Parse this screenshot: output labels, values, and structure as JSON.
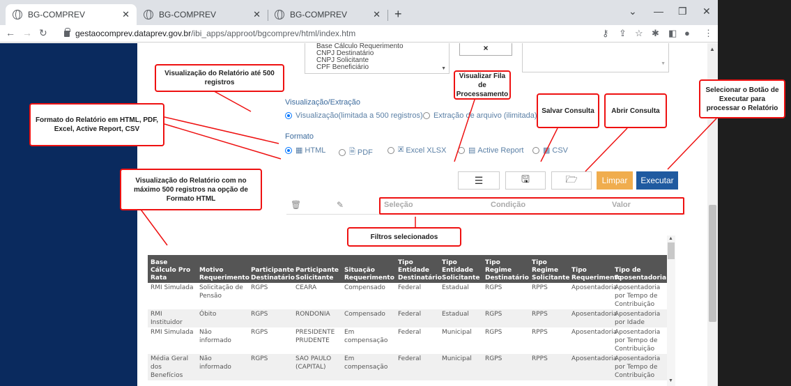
{
  "browser": {
    "tabs": [
      {
        "title": "BG-COMPREV",
        "active": true
      },
      {
        "title": "BG-COMPREV",
        "active": false
      },
      {
        "title": "BG-COMPREV",
        "active": false
      }
    ],
    "url_domain": "gestaocomprev.dataprev.gov.br",
    "url_path": "/ibi_apps/approot/bgcomprev/html/index.htm"
  },
  "listbox_items": [
    "Base Cálculo Requerimento",
    "CNPJ Destinatário",
    "CNPJ Solicitante",
    "CPF Beneficiário"
  ],
  "remove_button": "×",
  "visualizacao": {
    "label": "Visualização/Extração",
    "options": [
      {
        "label": "Visualização(limitada a 500 registros)",
        "selected": true
      },
      {
        "label": "Extração de arquivo (ilimitada)",
        "selected": false
      }
    ]
  },
  "formato": {
    "label": "Formato",
    "options": [
      {
        "label": "HTML",
        "icon": "table-icon",
        "selected": true
      },
      {
        "label": "PDF",
        "icon": "pdf-icon",
        "selected": false
      },
      {
        "label": "Excel XLSX",
        "icon": "excel-icon",
        "selected": false
      },
      {
        "label": "Active Report",
        "icon": "report-icon",
        "selected": false
      },
      {
        "label": "CSV",
        "icon": "grid-icon",
        "selected": false
      }
    ]
  },
  "buttons": {
    "limpar": "Limpar",
    "executar": "Executar"
  },
  "filters": {
    "columns": [
      "Seleção",
      "Condição",
      "Valor"
    ]
  },
  "annotations": {
    "ate500": "Visualização do Relatório até 500 registros",
    "formato": "Formato do Relatório em HTML, PDF, Excel, Active Report, CSV",
    "fila": "Visualizar Fila de Processamento",
    "salvar": "Salvar Consulta",
    "abrir": "Abrir Consulta",
    "executar": "Selecionar o Botão de Executar para processar o Relatório",
    "html500": "Visualização do Relatório com no máximo 500 registros na opção de Formato HTML",
    "filtros": "Filtros selecionados"
  },
  "table": {
    "headers": [
      "Base Cálculo Pro Rata",
      "Motivo Requerimento",
      "Participante Destinatário",
      "Participante Solicitante",
      "Situação Requerimento",
      "Tipo Entidade Destinatário",
      "Tipo Entidade Solicitante",
      "Tipo Regime Destinatário",
      "Tipo Regime Solicitante",
      "Tipo Requerimento",
      "Tipo de Aposentadoria"
    ],
    "rows": [
      [
        "RMI Simulada",
        "Solicitação de Pensão",
        "RGPS",
        "CEARA",
        "Compensado",
        "Federal",
        "Estadual",
        "RGPS",
        "RPPS",
        "Aposentadoria",
        "Aposentadoria por Tempo de Contribuição"
      ],
      [
        "RMI Instituidor",
        "Óbito",
        "RGPS",
        "RONDONIA",
        "Compensado",
        "Federal",
        "Estadual",
        "RGPS",
        "RPPS",
        "Aposentadoria",
        "Aposentadoria por Idade"
      ],
      [
        "RMI Simulada",
        "Não informado",
        "RGPS",
        "PRESIDENTE PRUDENTE",
        "Em compensação",
        "Federal",
        "Municipal",
        "RGPS",
        "RPPS",
        "Aposentadoria",
        "Aposentadoria por Tempo de Contribuição"
      ],
      [
        "Média Geral dos Benefícios",
        "Não informado",
        "RGPS",
        "SAO PAULO (CAPITAL)",
        "Em compensação",
        "Federal",
        "Municipal",
        "RGPS",
        "RPPS",
        "Aposentadoria",
        "Aposentadoria por Tempo de Contribuição"
      ]
    ]
  }
}
